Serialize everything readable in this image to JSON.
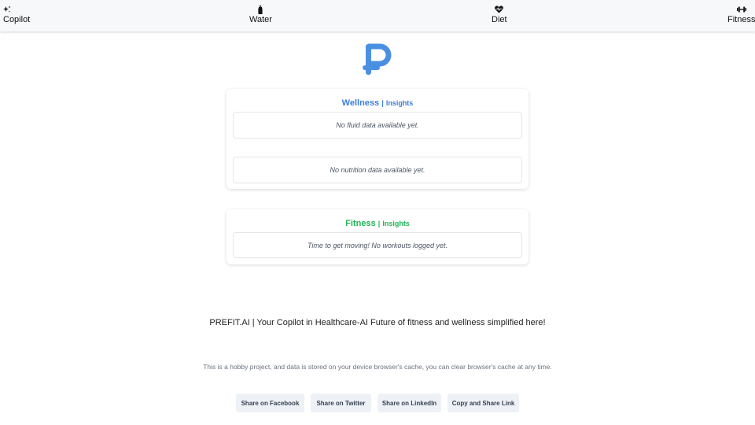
{
  "nav": {
    "items": [
      {
        "label": "Copilot",
        "icon": "sparkles-icon"
      },
      {
        "label": "Water",
        "icon": "bottle-icon"
      },
      {
        "label": "Diet",
        "icon": "heartbeat-icon"
      },
      {
        "label": "Fitness",
        "icon": "dumbbell-icon"
      }
    ]
  },
  "logo": {
    "glyph": "₽",
    "color": "#4a90e2"
  },
  "wellness": {
    "title": "Wellness",
    "separator": "|",
    "subtitle": "Insights",
    "fluid_empty": "No fluid data available yet.",
    "nutrition_empty": "No nutrition data available yet.",
    "color": "#3b7dd8"
  },
  "fitness": {
    "title": "Fitness",
    "separator": "|",
    "subtitle": "Insights",
    "workout_empty": "Time to get moving! No workouts logged yet.",
    "color": "#22b357"
  },
  "footer": {
    "tagline": "PREFIT.AI | Your Copilot in Healthcare-AI  Future of fitness and wellness simplified here!",
    "disclaimer": "This is a hobby project, and data is stored on your device browser's cache, you can clear browser's cache at any time."
  },
  "share": {
    "facebook": "Share on Facebook",
    "twitter": "Share on Twitter",
    "linkedin": "Share on LinkedIn",
    "copy": "Copy and Share Link"
  }
}
